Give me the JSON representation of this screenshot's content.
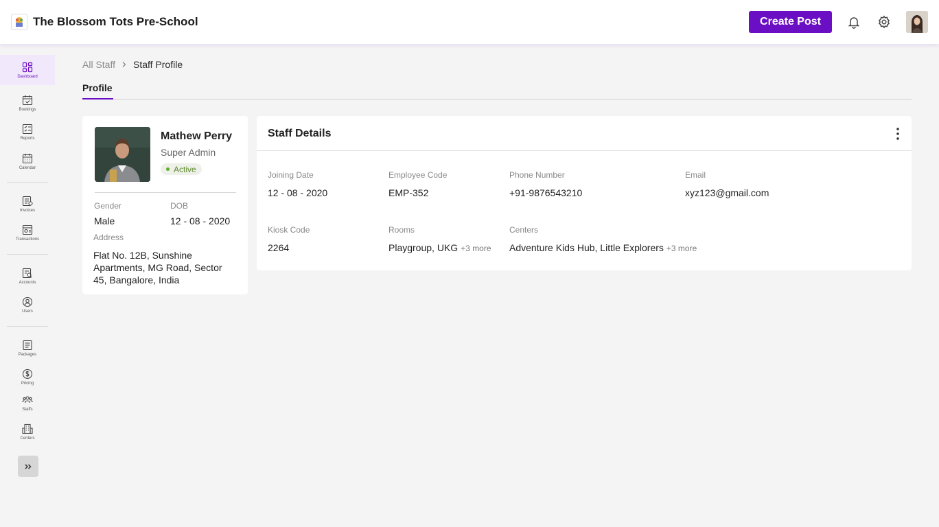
{
  "header": {
    "school_name": "The Blossom Tots Pre-School",
    "create_post_label": "Create Post",
    "accent_color": "#6b0fc4"
  },
  "sidebar": {
    "items": [
      {
        "label": "Dashboard",
        "icon": "dashboard-icon",
        "active": true
      },
      {
        "label": "Bookings",
        "icon": "calendar-check-icon"
      },
      {
        "label": "Reports",
        "icon": "reports-icon"
      },
      {
        "label": "Calendar",
        "icon": "calendar-icon"
      },
      {
        "label": "Invoices",
        "icon": "invoice-icon"
      },
      {
        "label": "Transactions",
        "icon": "transactions-icon"
      },
      {
        "label": "Accounts",
        "icon": "accounts-icon"
      },
      {
        "label": "Users",
        "icon": "user-icon"
      },
      {
        "label": "Packages",
        "icon": "packages-icon"
      },
      {
        "label": "Pricing",
        "icon": "dollar-icon"
      },
      {
        "label": "Staffs",
        "icon": "staffs-icon"
      },
      {
        "label": "Centers",
        "icon": "building-icon"
      }
    ]
  },
  "breadcrumb": {
    "parent": "All Staff",
    "current": "Staff Profile"
  },
  "tabs": {
    "profile": "Profile"
  },
  "profile": {
    "name": "Mathew Perry",
    "role": "Super Admin",
    "status": "Active",
    "gender_label": "Gender",
    "gender": "Male",
    "dob_label": "DOB",
    "dob": "12 - 08 - 2020",
    "address_label": "Address",
    "address": "Flat No. 12B, Sunshine Apartments, MG Road, Sector 45, Bangalore, India"
  },
  "details": {
    "title": "Staff Details",
    "joining_label": "Joining Date",
    "joining": "12 - 08 - 2020",
    "emp_code_label": "Employee Code",
    "emp_code": "EMP-352",
    "phone_label": "Phone Number",
    "phone": "+91-9876543210",
    "email_label": "Email",
    "email": "xyz123@gmail.com",
    "kiosk_label": "Kiosk Code",
    "kiosk": "2264",
    "rooms_label": "Rooms",
    "rooms": "Playgroup, UKG",
    "rooms_more": "+3 more",
    "centers_label": "Centers",
    "centers": "Adventure Kids Hub, Little Explorers",
    "centers_more": "+3 more"
  }
}
